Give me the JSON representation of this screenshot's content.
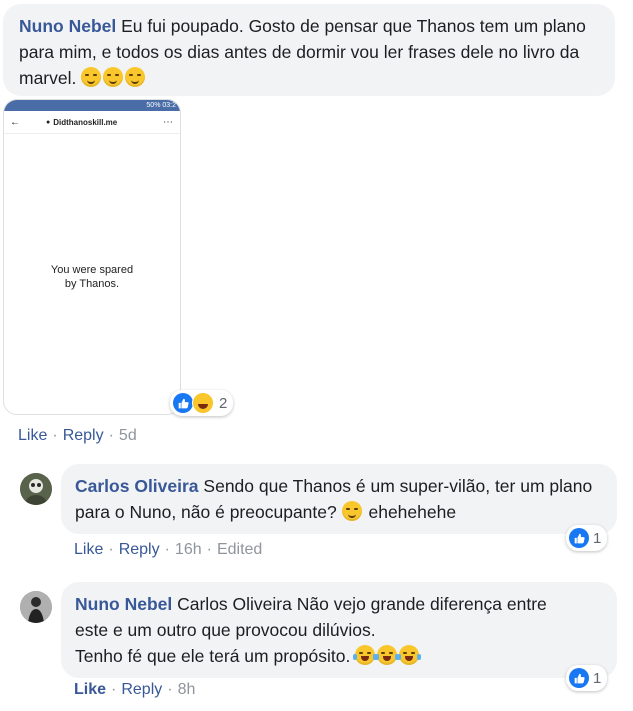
{
  "comment1": {
    "author": "Nuno Nebel",
    "text": "Eu fui poupado. Gosto de pensar que Thanos tem um plano para mim, e todos os dias antes de dormir vou ler frases dele no livro da marvel.",
    "emojis": [
      "smirk-face",
      "smirk-face",
      "smirk-face"
    ],
    "image": {
      "status": "50% 03:2",
      "url": "Didthanoskill.me",
      "message_line1": "You were spared",
      "message_line2": "by Thanos."
    },
    "reaction_count": "2",
    "actions": {
      "like": "Like",
      "reply": "Reply",
      "time": "5d"
    }
  },
  "reply1": {
    "author": "Carlos Oliveira",
    "text": "Sendo que Thanos é um super-vilão, ter um plano para o Nuno, não é preocupante?",
    "text_after_emoji": "ehehehehe",
    "reaction_count": "1",
    "actions": {
      "like": "Like",
      "reply": "Reply",
      "time": "16h",
      "edited": "Edited"
    }
  },
  "reply2": {
    "author": "Nuno Nebel",
    "mention": "Carlos Oliveira",
    "text_line1": "Não vejo grande diferença entre",
    "text_line2": "este e um outro que provocou dilúvios.",
    "text_line3": "Tenho fé que ele terá um propósito.",
    "reaction_count": "1",
    "actions": {
      "like": "Like",
      "reply": "Reply",
      "time": "8h"
    }
  },
  "colors": {
    "link": "#385898",
    "bubble": "#f2f3f5",
    "like_blue": "#1877f2",
    "muted": "#90949c"
  }
}
